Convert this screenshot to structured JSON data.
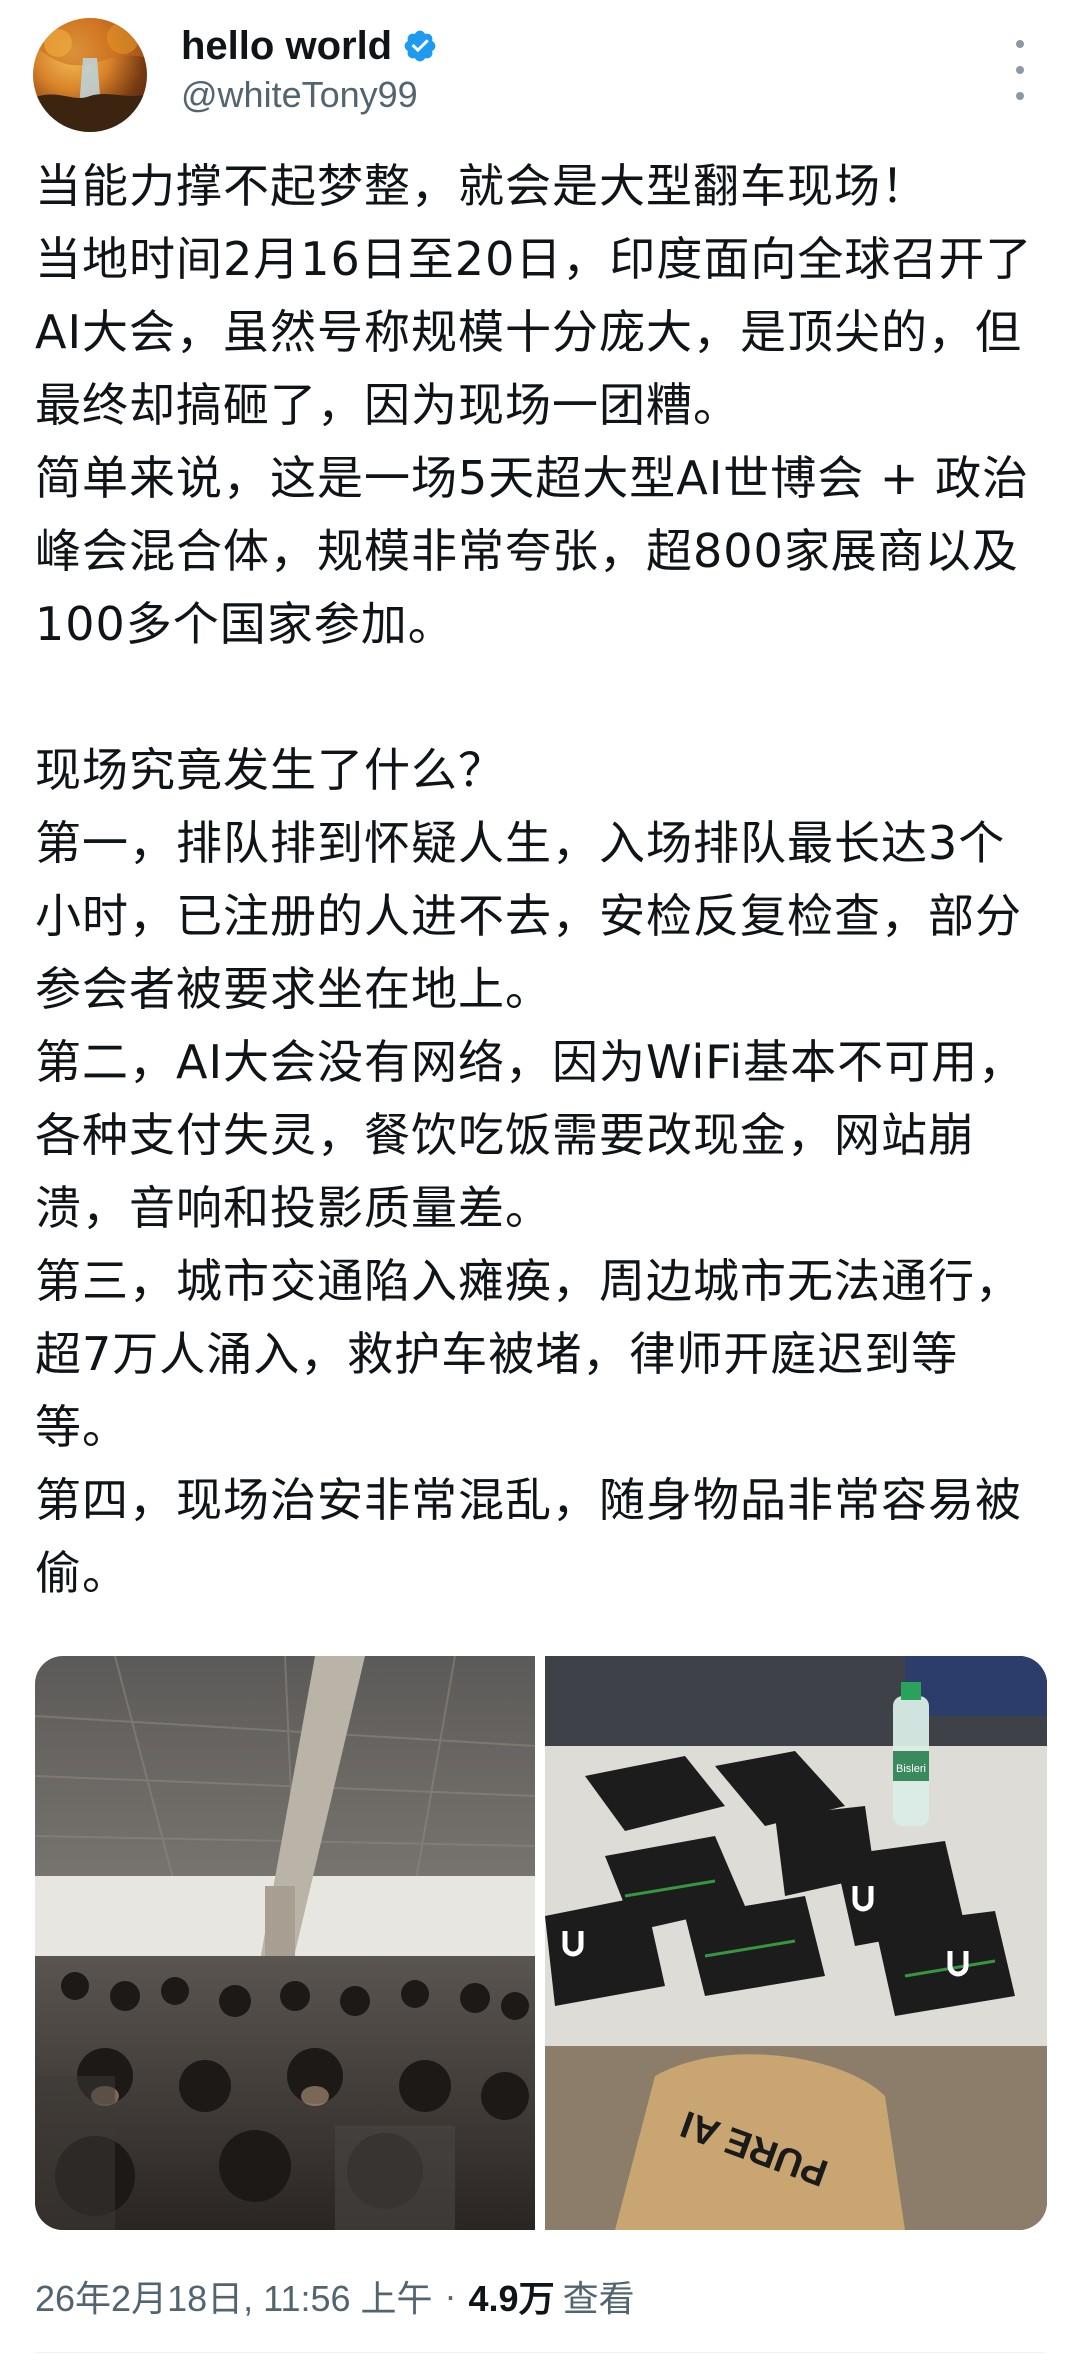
{
  "author": {
    "display_name": "hello world",
    "handle": "@whiteTony99",
    "verified": true,
    "avatar_icon": "avatar-autumn-waterfall"
  },
  "tweet": {
    "paragraphs": [
      "当能力撑不起梦整，就会是大型翻车现场！",
      "当地时间2月16日至20日，印度面向全球召开了AI大会，虽然号称规模十分庞大，是顶尖的，但最终却搞砸了，因为现场一团糟。",
      "简单来说，这是一场5天超大型AI世博会 + 政治峰会混合体，规模非常夸张，超800家展商以及100多个国家参加。",
      "",
      "现场究竟发生了什么？",
      "第一，排队排到怀疑人生，入场排队最长达3个小时，已注册的人进不去，安检反复检查，部分参会者被要求坐在地上。",
      "第二，AI大会没有网络，因为WiFi基本不可用，各种支付失灵，餐饮吃饭需要改现金，网站崩溃，音响和投影质量差。",
      "第三，城市交通陷入瘫痪，周边城市无法通行，超7万人涌入，救护车被堵，律师开庭迟到等等。",
      "第四，现场治安非常混乱，随身物品非常容易被偷。"
    ]
  },
  "media": {
    "left": {
      "description_icon": "crowd-photo",
      "sign_text": ""
    },
    "right": {
      "description_icon": "boxes-on-table-photo",
      "bag_text": "PURE AI",
      "bottle_label": "Bisleri"
    }
  },
  "meta": {
    "timestamp": "26年2月18日, 11:56 上午",
    "separator": "·",
    "views_count": "4.9万",
    "views_label": "查看"
  },
  "colors": {
    "text": "#0f1419",
    "secondary": "#536471",
    "verified_blue": "#1d9bf0"
  }
}
